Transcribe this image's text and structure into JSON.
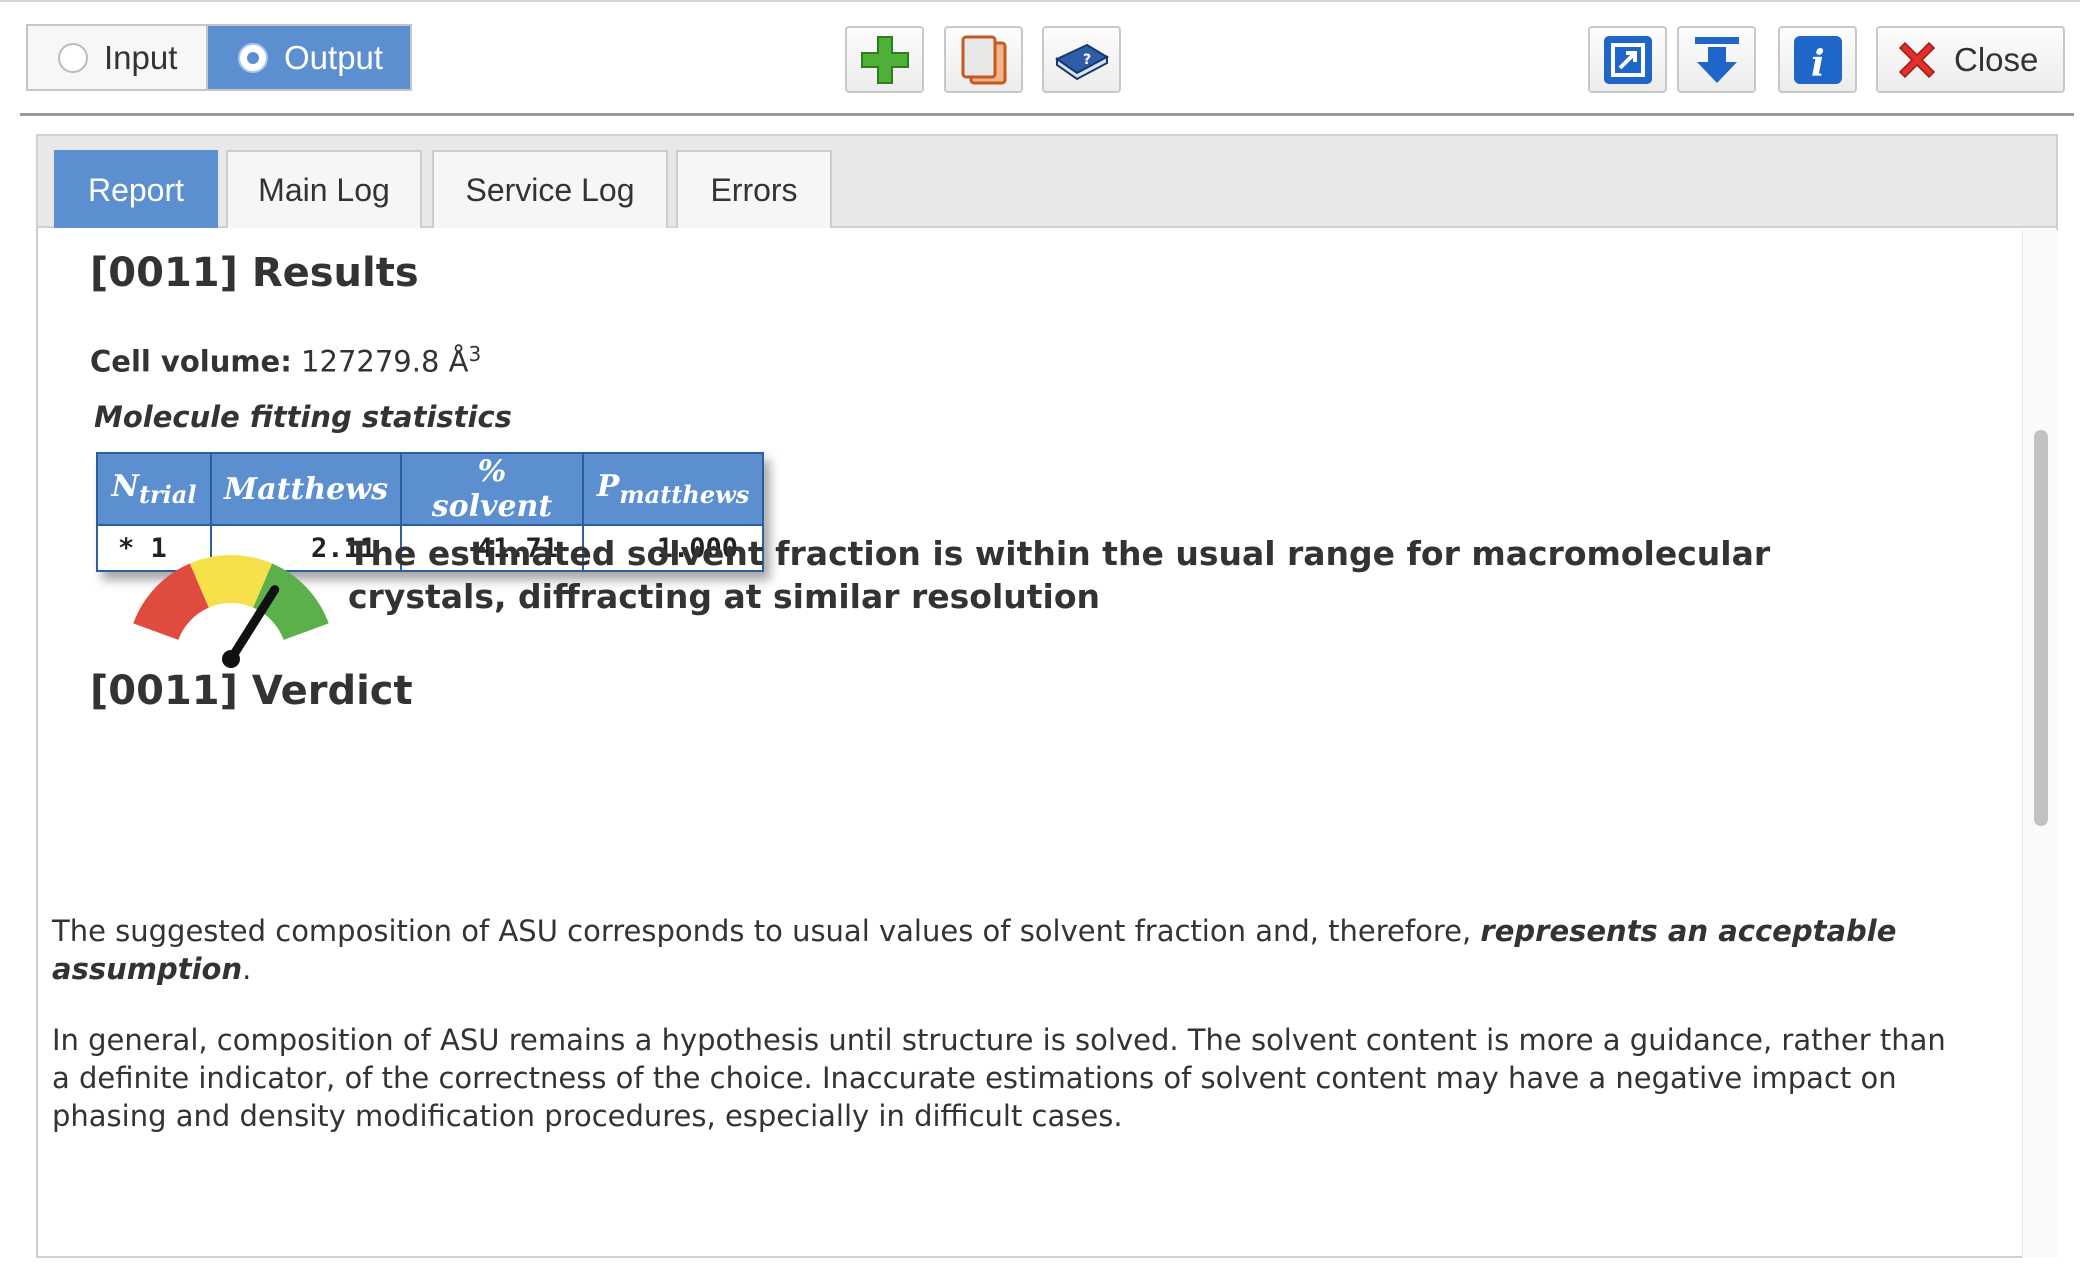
{
  "toolbar": {
    "radio_input": "Input",
    "radio_output": "Output",
    "selected": "Output",
    "icons": [
      "add-icon",
      "clone-icon",
      "help-book-icon",
      "export-icon",
      "download-icon",
      "info-icon",
      "close-icon"
    ],
    "close_label": "Close"
  },
  "tabs": [
    "Report",
    "Main Log",
    "Service Log",
    "Errors"
  ],
  "active_tab": "Report",
  "report": {
    "results_title": "[0011] Results",
    "cell_volume_label": "Cell volume:",
    "cell_volume_value": "127279.8 Å",
    "cell_volume_exp": "3",
    "table_caption": "Molecule fitting statistics",
    "table_headers": [
      {
        "main": "N",
        "sub": "trial"
      },
      {
        "main": "Matthews",
        "sub": ""
      },
      {
        "main": "% solvent",
        "sub": ""
      },
      {
        "main": "P",
        "sub": "matthews"
      }
    ],
    "table_rows": [
      [
        "* 1",
        "2.11",
        "41.71",
        "1.000"
      ]
    ],
    "verdict_title": "[0011] Verdict",
    "gauge_level": 0.73,
    "gauge_colors": [
      "#e04b3f",
      "#f6e14a",
      "#5bb04a"
    ],
    "verdict_message": "The estimated solvent fraction is within the usual range for macromolecular crystals, diffracting at similar resolution",
    "para1_text": "The suggested composition of ASU corresponds to usual values of solvent fraction and, therefore, ",
    "para1_emph": "represents an acceptable assumption",
    "para1_end": ".",
    "para2": "In general, composition of ASU remains a hypothesis until structure is solved. The solvent content is more a guidance, rather than a definite indicator, of the correctness of the choice. Inaccurate estimations of solvent content may have a negative impact on phasing and density modification procedures, especially in difficult cases."
  },
  "colors": {
    "accent": "#5b8fd0",
    "table_border": "#2d5f9e"
  }
}
